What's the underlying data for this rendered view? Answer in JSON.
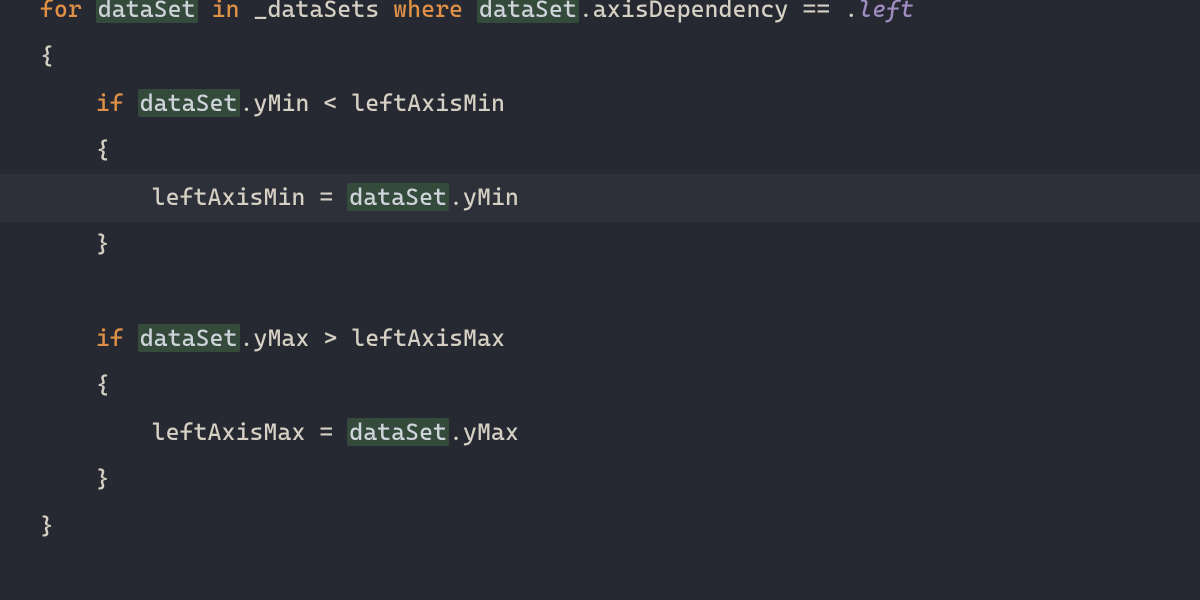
{
  "colors": {
    "background": "#262931",
    "text": "#d6d0c4",
    "keyword": "#e09146",
    "enum": "#a08cc0",
    "selection_bg": "#344a3b",
    "current_line_bg": "rgba(255,255,255,0.035)"
  },
  "editor": {
    "font_px": 23.5,
    "line_height_px": 47,
    "highlighted_line_index": 4,
    "lines": [
      [
        {
          "t": "for ",
          "c": "kw"
        },
        {
          "t": "dataSet",
          "c": "sel"
        },
        {
          "t": " ",
          "c": "id"
        },
        {
          "t": "in",
          "c": "kw"
        },
        {
          "t": " _dataSets ",
          "c": "id"
        },
        {
          "t": "where",
          "c": "kw"
        },
        {
          "t": " ",
          "c": "id"
        },
        {
          "t": "dataSet",
          "c": "sel"
        },
        {
          "t": ".axisDependency == .",
          "c": "id"
        },
        {
          "t": "left",
          "c": "enum"
        }
      ],
      [
        {
          "t": "{",
          "c": "brace"
        }
      ],
      [
        {
          "t": "    ",
          "c": "id"
        },
        {
          "t": "if",
          "c": "kw"
        },
        {
          "t": " ",
          "c": "id"
        },
        {
          "t": "dataSet",
          "c": "sel"
        },
        {
          "t": ".yMin < leftAxisMin",
          "c": "id"
        }
      ],
      [
        {
          "t": "    {",
          "c": "brace"
        }
      ],
      [
        {
          "t": "        leftAxisMin = ",
          "c": "id"
        },
        {
          "t": "dataSet",
          "c": "sel"
        },
        {
          "t": ".yMin",
          "c": "id"
        }
      ],
      [
        {
          "t": "    }",
          "c": "brace"
        }
      ],
      [],
      [
        {
          "t": "    ",
          "c": "id"
        },
        {
          "t": "if",
          "c": "kw"
        },
        {
          "t": " ",
          "c": "id"
        },
        {
          "t": "dataSet",
          "c": "sel"
        },
        {
          "t": ".yMax > leftAxisMax",
          "c": "id"
        }
      ],
      [
        {
          "t": "    {",
          "c": "brace"
        }
      ],
      [
        {
          "t": "        leftAxisMax = ",
          "c": "id"
        },
        {
          "t": "dataSet",
          "c": "sel"
        },
        {
          "t": ".yMax",
          "c": "id"
        }
      ],
      [
        {
          "t": "    }",
          "c": "brace"
        }
      ],
      [
        {
          "t": "}",
          "c": "brace"
        }
      ]
    ]
  }
}
